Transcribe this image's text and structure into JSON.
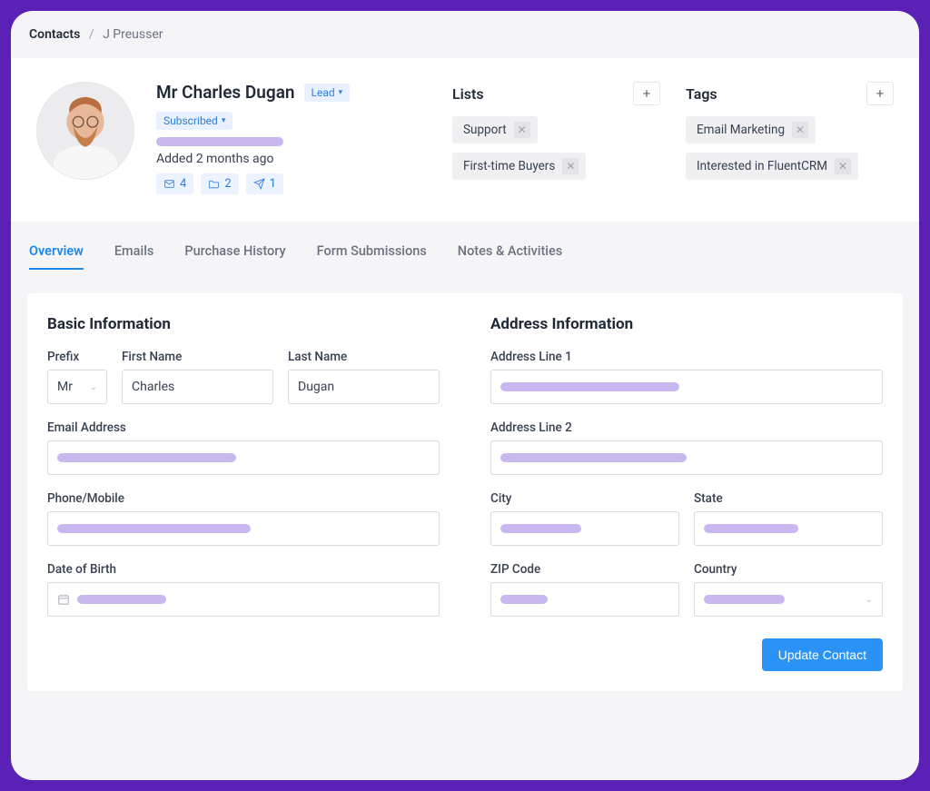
{
  "breadcrumb": {
    "root": "Contacts",
    "current": "J Preusser"
  },
  "profile": {
    "full_name": "Mr Charles Dugan",
    "status_1": "Lead",
    "status_2": "Subscribed",
    "added_text": "Added 2 months ago",
    "stats": {
      "emails": "4",
      "folders": "2",
      "sends": "1"
    }
  },
  "lists": {
    "heading": "Lists",
    "items": [
      "Support",
      "First-time Buyers"
    ]
  },
  "tags": {
    "heading": "Tags",
    "items": [
      "Email Marketing",
      "Interested in FluentCRM"
    ]
  },
  "tabs": {
    "overview": "Overview",
    "emails": "Emails",
    "purchase": "Purchase History",
    "forms": "Form Submissions",
    "notes": "Notes & Activities",
    "active": "overview"
  },
  "form": {
    "basic": {
      "title": "Basic Information",
      "prefix_label": "Prefix",
      "prefix_value": "Mr",
      "first_name_label": "First Name",
      "first_name_value": "Charles",
      "last_name_label": "Last Name",
      "last_name_value": "Dugan",
      "email_label": "Email Address",
      "phone_label": "Phone/Mobile",
      "dob_label": "Date of Birth"
    },
    "address": {
      "title": "Address Information",
      "line1_label": "Address Line 1",
      "line2_label": "Address Line 2",
      "city_label": "City",
      "state_label": "State",
      "zip_label": "ZIP Code",
      "country_label": "Country"
    },
    "submit_label": "Update Contact"
  }
}
